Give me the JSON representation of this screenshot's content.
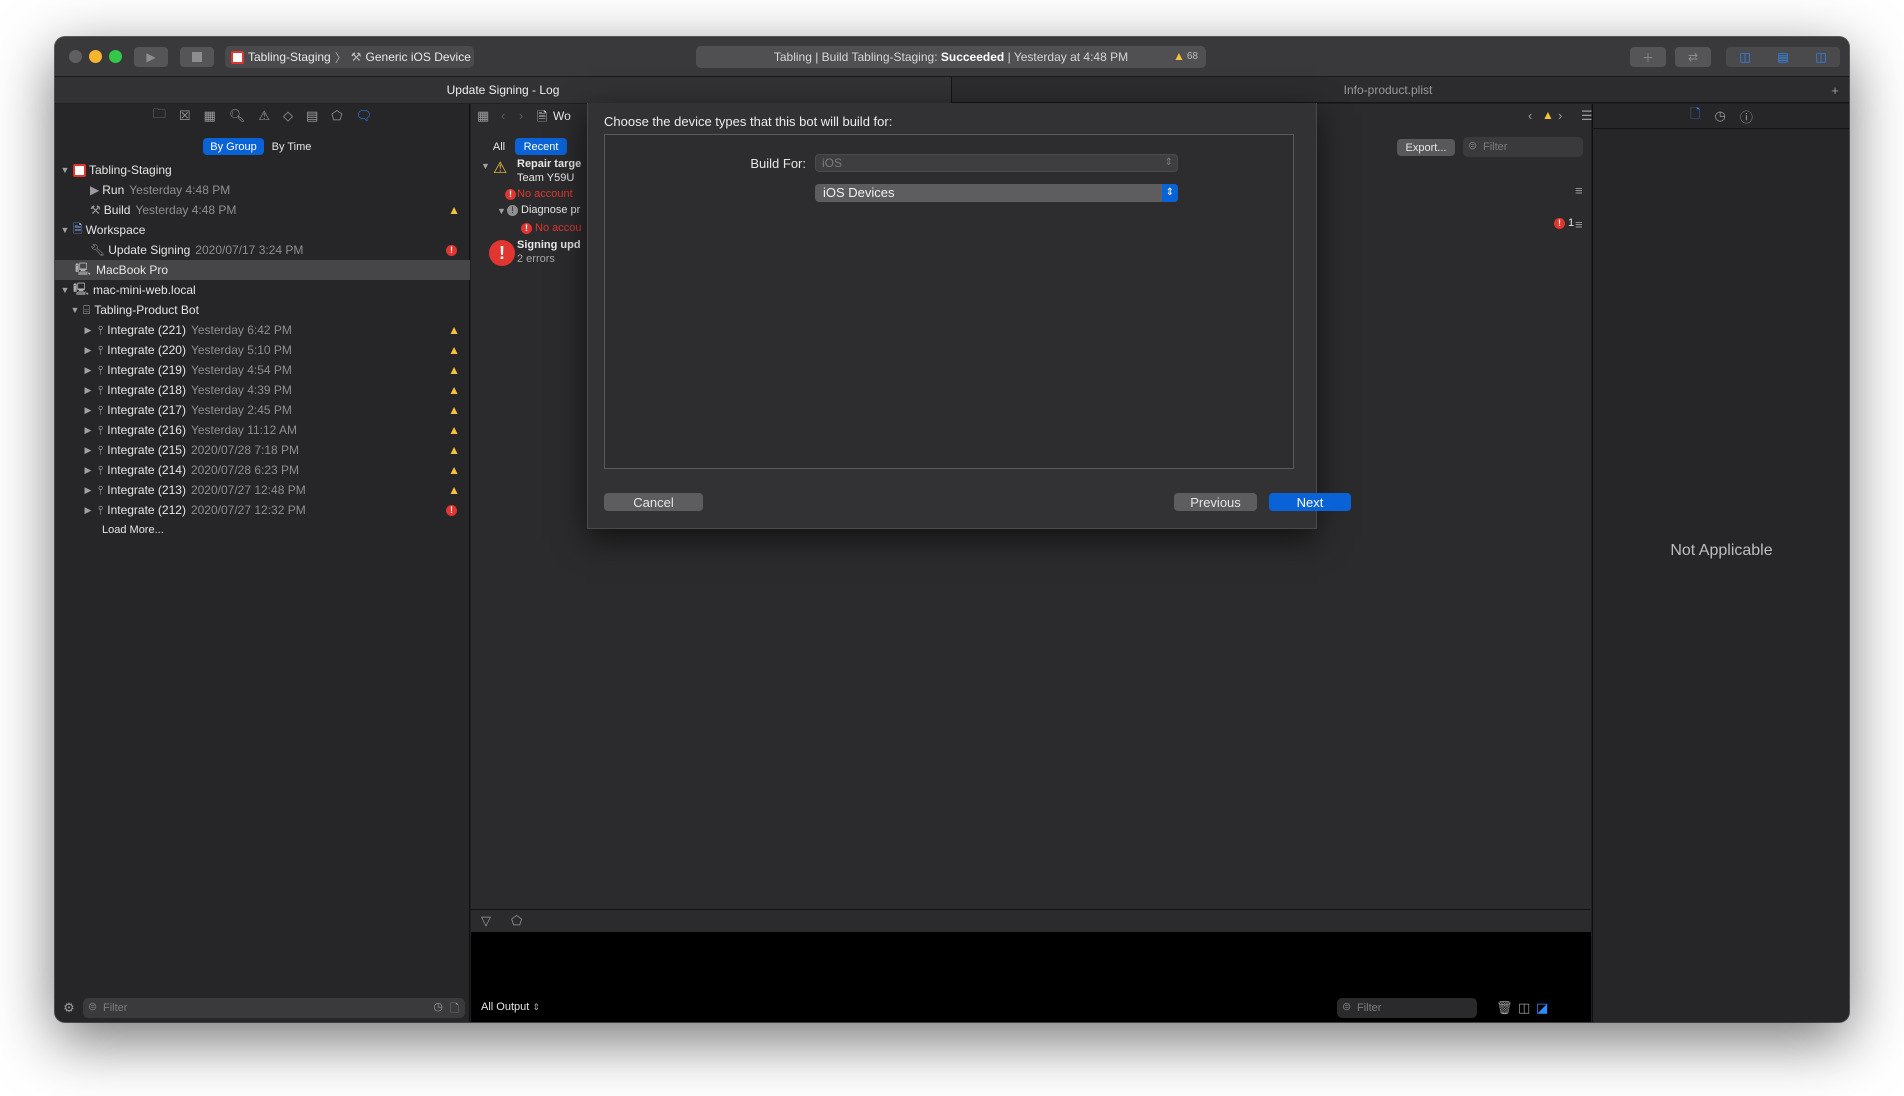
{
  "toolbar": {
    "scheme": "Tabling-Staging",
    "destination": "Generic iOS Device",
    "status_prefix": "Tabling | Build Tabling-Staging: ",
    "status_result": "Succeeded",
    "status_suffix": " | Yesterday at 4:48 PM",
    "warning_count": "68"
  },
  "tabs": {
    "left": "Update Signing - Log",
    "right": "Info-product.plist"
  },
  "navigator": {
    "seg_group": "By Group",
    "seg_time": "By Time",
    "project": "Tabling-Staging",
    "run_label": "Run",
    "run_time": "Yesterday 4:48 PM",
    "build_label": "Build",
    "build_time": "Yesterday 4:48 PM",
    "workspace": "Workspace",
    "update_label": "Update Signing",
    "update_time": "2020/07/17 3:24 PM",
    "macbook": "MacBook Pro",
    "server": "mac-mini-web.local",
    "bot": "Tabling-Product Bot",
    "integrations": [
      {
        "label": "Integrate (221)",
        "time": "Yesterday 6:42 PM",
        "status": "warning"
      },
      {
        "label": "Integrate (220)",
        "time": "Yesterday 5:10 PM",
        "status": "warning"
      },
      {
        "label": "Integrate (219)",
        "time": "Yesterday 4:54 PM",
        "status": "warning"
      },
      {
        "label": "Integrate (218)",
        "time": "Yesterday 4:39 PM",
        "status": "warning"
      },
      {
        "label": "Integrate (217)",
        "time": "Yesterday 2:45 PM",
        "status": "warning"
      },
      {
        "label": "Integrate (216)",
        "time": "Yesterday 11:12 AM",
        "status": "warning"
      },
      {
        "label": "Integrate (215)",
        "time": "2020/07/28 7:18 PM",
        "status": "warning"
      },
      {
        "label": "Integrate (214)",
        "time": "2020/07/28 6:23 PM",
        "status": "warning"
      },
      {
        "label": "Integrate (213)",
        "time": "2020/07/27 12:48 PM",
        "status": "warning"
      },
      {
        "label": "Integrate (212)",
        "time": "2020/07/27 12:32 PM",
        "status": "error"
      }
    ],
    "load_more": "Load More...",
    "filter_placeholder": "Filter"
  },
  "editor": {
    "crumb": "Wo",
    "seg_all": "All",
    "seg_recent": "Recent",
    "export_label": "Export...",
    "filter_placeholder": "Filter",
    "log_items": {
      "repair_title": "Repair targe",
      "repair_sub": "Team Y59U",
      "no_account_1": "No account",
      "diagnose": "Diagnose pr",
      "no_account_2": "No accou",
      "signing_title": "Signing upd",
      "signing_sub": "2 errors"
    },
    "error_badge": "1",
    "all_output": "All Output",
    "debug_filter_placeholder": "Filter"
  },
  "sheet": {
    "title": "Choose the device types that this bot will build for:",
    "build_for_label": "Build For:",
    "platform_value": "iOS",
    "device_value": "iOS Devices",
    "cancel": "Cancel",
    "previous": "Previous",
    "next": "Next"
  },
  "inspector": {
    "not_applicable": "Not Applicable"
  },
  "colors": {
    "accent": "#0a63d6",
    "warning": "#f3c13a",
    "error": "#e0362f"
  }
}
